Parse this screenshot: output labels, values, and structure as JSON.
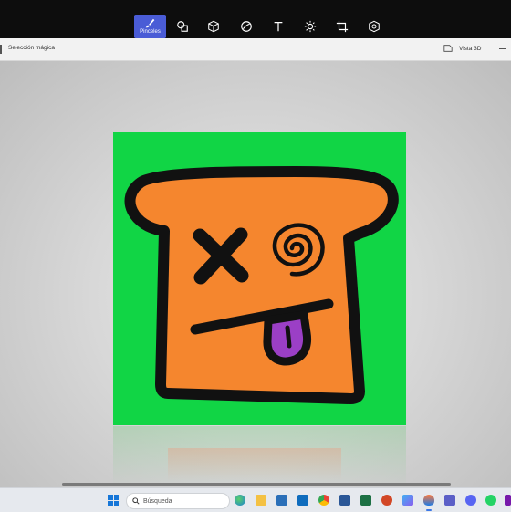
{
  "app": {
    "toolbar": {
      "brushes_label": "Pinceles",
      "tools": [
        {
          "name": "brushes-tool",
          "icon": "brush-icon",
          "active": true
        },
        {
          "name": "2d-shapes-tool",
          "icon": "2d-shapes-icon"
        },
        {
          "name": "3d-shapes-tool",
          "icon": "3d-cube-icon"
        },
        {
          "name": "stickers-tool",
          "icon": "sticker-icon"
        },
        {
          "name": "text-tool",
          "icon": "text-icon"
        },
        {
          "name": "effects-tool",
          "icon": "effects-sun-icon"
        },
        {
          "name": "canvas-tool",
          "icon": "canvas-crop-icon"
        },
        {
          "name": "3d-library-tool",
          "icon": "3d-library-icon"
        }
      ]
    },
    "subbar": {
      "magic_select_label": "Selección mágica",
      "view_3d_label": "Vista 3D"
    },
    "canvas": {
      "background_color": "#11d545",
      "toast_color": "#f5862e",
      "tongue_color": "#9b3fc6",
      "outline_color": "#111111"
    }
  },
  "taskbar": {
    "search_placeholder": "Búsqueda",
    "apps": [
      "weather-app-icon",
      "file-explorer-icon",
      "microsoft-store-icon",
      "outlook-icon",
      "chrome-icon",
      "word-icon",
      "excel-icon",
      "powerpoint-icon",
      "photos-icon",
      "paint-3d-icon",
      "teams-icon",
      "discord-icon",
      "whatsapp-icon",
      "onenote-icon"
    ]
  }
}
